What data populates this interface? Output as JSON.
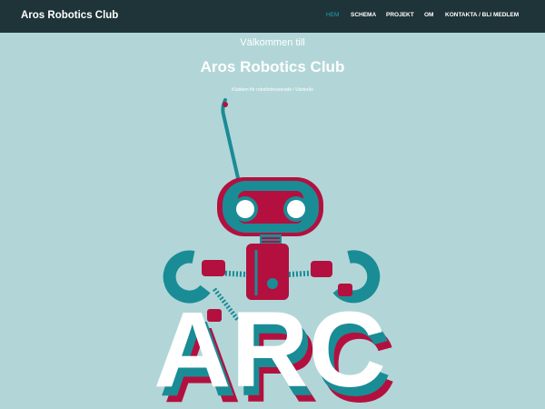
{
  "nav": {
    "brand": "Aros Robotics Club",
    "links": [
      {
        "label": "HEM",
        "active": true
      },
      {
        "label": "SCHEMA",
        "active": false
      },
      {
        "label": "PROJEKT",
        "active": false
      },
      {
        "label": "OM",
        "active": false
      },
      {
        "label": "KONTAKTA / BLI MEDLEM",
        "active": false
      }
    ]
  },
  "hero": {
    "pretitle": "Välkommen till",
    "title": "Aros Robotics Club",
    "subtitle": "Klubben för robotintresserade i Västerås",
    "logo_text": "ARC"
  },
  "colors": {
    "nav_bg": "#1f3438",
    "page_bg": "#b2d6d7",
    "accent_teal": "#1a8c96",
    "accent_red": "#b3103f",
    "active_link": "#19a3b3"
  }
}
